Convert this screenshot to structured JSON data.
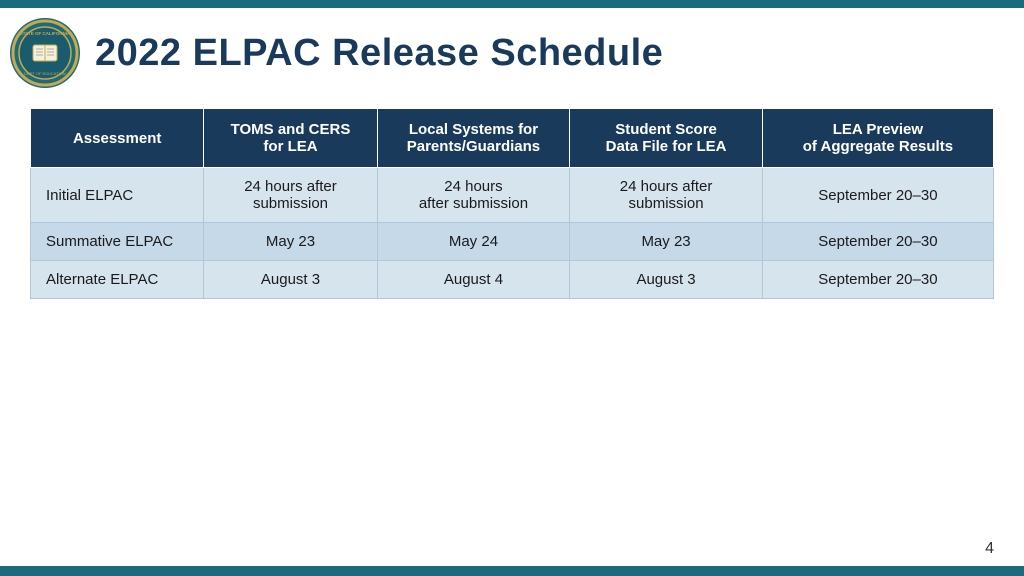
{
  "header": {
    "title": "2022 ELPAC Release Schedule"
  },
  "table": {
    "columns": [
      {
        "id": "assessment",
        "label": "Assessment"
      },
      {
        "id": "toms",
        "label": "TOMS and CERS\nfor LEA"
      },
      {
        "id": "local",
        "label": "Local Systems for\nParents/Guardians"
      },
      {
        "id": "student",
        "label": "Student Score\nData File for LEA"
      },
      {
        "id": "lea",
        "label": "LEA Preview\nof Aggregate Results"
      }
    ],
    "rows": [
      {
        "assessment": "Initial ELPAC",
        "toms": "24 hours after\nsubmission",
        "local": "24 hours\nafter submission",
        "student": "24 hours after\nsubmission",
        "lea": "September 20–30"
      },
      {
        "assessment": "Summative ELPAC",
        "toms": "May 23",
        "local": "May 24",
        "student": "May 23",
        "lea": "September 20–30"
      },
      {
        "assessment": "Alternate ELPAC",
        "toms": "August 3",
        "local": "August 4",
        "student": "August 3",
        "lea": "September 20–30"
      }
    ]
  },
  "page_number": "4"
}
